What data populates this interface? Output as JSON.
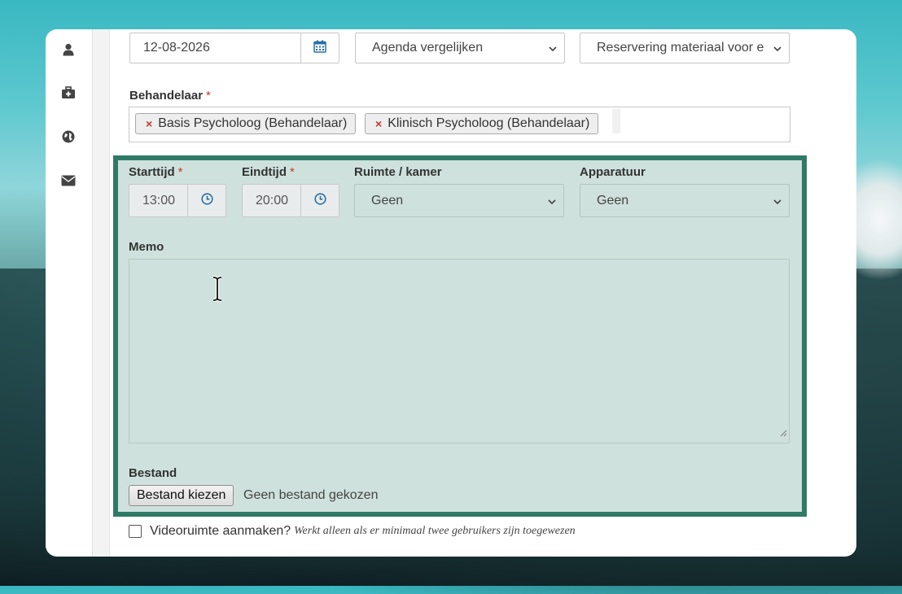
{
  "date": {
    "value": "12-08-2026"
  },
  "agenda_select": {
    "selected": "Agenda vergelijken"
  },
  "reservation_select": {
    "selected": "Reservering materiaal voor e"
  },
  "behandelaar": {
    "label": "Behandelaar",
    "required_mark": "*",
    "tags": [
      "Basis Psycholoog (Behandelaar)",
      "Klinisch Psycholoog (Behandelaar)"
    ],
    "remove_symbol": "×"
  },
  "starttijd": {
    "label": "Starttijd",
    "required_mark": "*",
    "value": "13:00"
  },
  "eindtijd": {
    "label": "Eindtijd",
    "required_mark": "*",
    "value": "20:00"
  },
  "ruimte": {
    "label": "Ruimte / kamer",
    "selected": "Geen"
  },
  "apparatuur": {
    "label": "Apparatuur",
    "selected": "Geen"
  },
  "memo": {
    "label": "Memo",
    "value": ""
  },
  "bestand": {
    "label": "Bestand",
    "button": "Bestand kiezen",
    "status": "Geen bestand gekozen"
  },
  "video": {
    "label": "Videoruimte aanmaken?",
    "hint": "Werkt alleen als er minimaal twee gebruikers zijn toegewezen",
    "checked": false
  },
  "sidebar": {
    "icons": [
      "user-icon",
      "medical-kit-icon",
      "globe-icon",
      "envelope-icon"
    ]
  },
  "colors": {
    "accent": "#2f7a64",
    "panel": "#cfe1dc",
    "icon_blue": "#2a6fa8",
    "required": "#c0392b"
  }
}
